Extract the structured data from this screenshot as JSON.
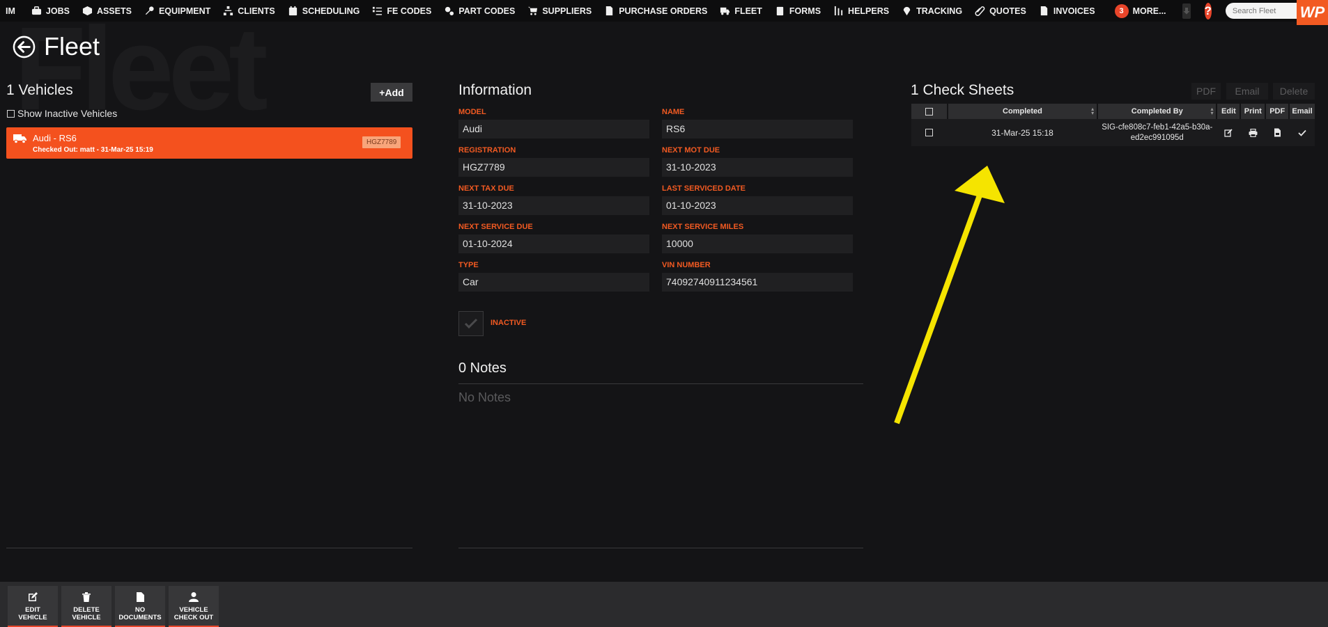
{
  "nav": {
    "first": "IM",
    "items": [
      {
        "label": "JOBS",
        "icon": "briefcase-icon"
      },
      {
        "label": "ASSETS",
        "icon": "cube-icon"
      },
      {
        "label": "EQUIPMENT",
        "icon": "wrench-icon"
      },
      {
        "label": "CLIENTS",
        "icon": "sitemap-icon"
      },
      {
        "label": "SCHEDULING",
        "icon": "calendar-icon"
      },
      {
        "label": "FE CODES",
        "icon": "list-check-icon"
      },
      {
        "label": "PART CODES",
        "icon": "gears-icon"
      },
      {
        "label": "SUPPLIERS",
        "icon": "cart-icon"
      },
      {
        "label": "PURCHASE ORDERS",
        "icon": "document-icon"
      },
      {
        "label": "FLEET",
        "icon": "truck-icon"
      },
      {
        "label": "FORMS",
        "icon": "clipboard-icon"
      },
      {
        "label": "HELPERS",
        "icon": "helpers-icon"
      },
      {
        "label": "TRACKING",
        "icon": "map-pin-icon"
      },
      {
        "label": "QUOTES",
        "icon": "paperclip-icon"
      },
      {
        "label": "INVOICES",
        "icon": "invoice-icon"
      }
    ],
    "more_count": "3",
    "more_label": "MORE...",
    "help": "?",
    "search_placeholder": "Search Fleet",
    "logo": "WP"
  },
  "page": {
    "watermark": "Fleet",
    "title": "Fleet"
  },
  "vehicles": {
    "heading": "1 Vehicles",
    "add_label": "+Add",
    "show_inactive_label": "Show Inactive Vehicles",
    "list": [
      {
        "name": "Audi - RS6",
        "status": "Checked Out: matt - 31-Mar-25 15:19",
        "registration": "HGZ7789"
      }
    ]
  },
  "information": {
    "heading": "Information",
    "fields": {
      "model": {
        "label": "MODEL",
        "value": "Audi"
      },
      "name": {
        "label": "NAME",
        "value": "RS6"
      },
      "registration": {
        "label": "REGISTRATION",
        "value": "HGZ7789"
      },
      "next_mot_due": {
        "label": "NEXT MOT DUE",
        "value": "31-10-2023"
      },
      "next_tax_due": {
        "label": "NEXT TAX DUE",
        "value": "31-10-2023"
      },
      "last_serviced": {
        "label": "LAST SERVICED DATE",
        "value": "01-10-2023"
      },
      "next_service_due": {
        "label": "NEXT SERVICE DUE",
        "value": "01-10-2024"
      },
      "next_service_miles": {
        "label": "NEXT SERVICE MILES",
        "value": "10000"
      },
      "type": {
        "label": "TYPE",
        "value": "Car"
      },
      "vin": {
        "label": "VIN NUMBER",
        "value": "74092740911234561"
      }
    },
    "inactive_label": "INACTIVE",
    "notes_heading": "0 Notes",
    "no_notes": "No Notes"
  },
  "check_sheets": {
    "heading": "1 Check Sheets",
    "actions": {
      "pdf": "PDF",
      "email": "Email",
      "delete": "Delete"
    },
    "columns": {
      "completed": "Completed",
      "completed_by": "Completed By",
      "edit": "Edit",
      "print": "Print",
      "pdf": "PDF",
      "email": "Email"
    },
    "rows": [
      {
        "completed": "31-Mar-25 15:18",
        "completed_by": "SIG-cfe808c7-feb1-42a5-b30a-ed2ec991095d"
      }
    ]
  },
  "annotation": {
    "color": "#f5e400"
  },
  "toolbar": {
    "edit": "EDIT\nVEHICLE",
    "delete": "DELETE\nVEHICLE",
    "documents": "NO\nDOCUMENTS",
    "checkout": "VEHICLE\nCHECK OUT"
  },
  "colors": {
    "accent": "#f25a22",
    "background": "#141416"
  }
}
